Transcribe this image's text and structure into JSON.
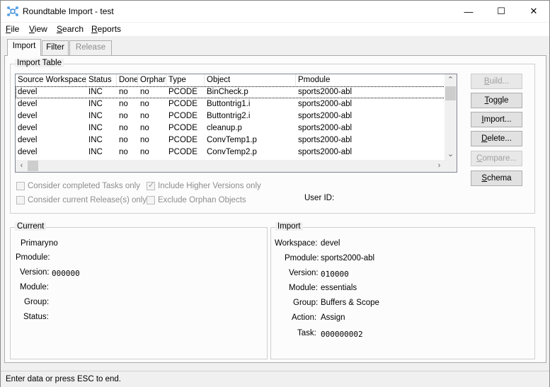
{
  "window": {
    "title": "Roundtable Import - test",
    "controls": {
      "minimize": "—",
      "maximize": "☐",
      "close": "✕"
    }
  },
  "menu": [
    {
      "label": "File",
      "accel": "F",
      "rest": "ile"
    },
    {
      "label": "View",
      "accel": "V",
      "rest": "iew"
    },
    {
      "label": "Search",
      "accel": "S",
      "rest": "earch"
    },
    {
      "label": "Reports",
      "accel": "R",
      "rest": "eports"
    }
  ],
  "tabs": [
    {
      "label": "Import",
      "state": "active"
    },
    {
      "label": "Filter",
      "state": "normal"
    },
    {
      "label": "Release",
      "state": "disabled"
    }
  ],
  "import_table": {
    "group_label": "Import Table",
    "columns": [
      "Source Workspace",
      "Status",
      "Done",
      "Orphan",
      "Type",
      "Object",
      "Pmodule"
    ],
    "rows": [
      [
        "devel",
        "INC",
        "no",
        "no",
        "PCODE",
        "BinCheck.p",
        "sports2000-abl"
      ],
      [
        "devel",
        "INC",
        "no",
        "no",
        "PCODE",
        "Buttontrig1.i",
        "sports2000-abl"
      ],
      [
        "devel",
        "INC",
        "no",
        "no",
        "PCODE",
        "Buttontrig2.i",
        "sports2000-abl"
      ],
      [
        "devel",
        "INC",
        "no",
        "no",
        "PCODE",
        "cleanup.p",
        "sports2000-abl"
      ],
      [
        "devel",
        "INC",
        "no",
        "no",
        "PCODE",
        "ConvTemp1.p",
        "sports2000-abl"
      ],
      [
        "devel",
        "INC",
        "no",
        "no",
        "PCODE",
        "ConvTemp2.p",
        "sports2000-abl"
      ]
    ],
    "selected_row": 0
  },
  "buttons": {
    "build": {
      "accel": "B",
      "rest": "uild...",
      "enabled": false
    },
    "toggle": {
      "accel": "T",
      "rest": "oggle",
      "enabled": true
    },
    "import": {
      "accel": "I",
      "rest": "mport...",
      "enabled": true
    },
    "delete": {
      "accel": "D",
      "rest": "elete...",
      "enabled": true
    },
    "compare": {
      "accel": "C",
      "rest": "ompare...",
      "enabled": false
    },
    "schema": {
      "accel": "S",
      "rest": "chema",
      "enabled": true
    }
  },
  "options": {
    "completed_tasks": {
      "label": "Consider completed Tasks only",
      "checked": false
    },
    "higher_versions": {
      "label": "Include Higher Versions only",
      "checked": true
    },
    "current_release": {
      "label": "Consider current Release(s) only",
      "checked": false
    },
    "exclude_orphan": {
      "label": "Exclude Orphan Objects",
      "checked": false
    },
    "user_id_label": "User ID:"
  },
  "current": {
    "group_label": "Current",
    "primary_label": "Primary:",
    "primary_value": "no",
    "pmodule_label": "Pmodule:",
    "version_label": "Version:",
    "version_value": "000000",
    "module_label": "Module:",
    "group_field_label": "Group:",
    "status_label": "Status:"
  },
  "import": {
    "group_label": "Import",
    "workspace_label": "Workspace:",
    "workspace_value": "devel",
    "pmodule_label": "Pmodule:",
    "pmodule_value": "sports2000-abl",
    "version_label": "Version:",
    "version_value": "010000",
    "module_label": "Module:",
    "module_value": "essentials",
    "group_field_label": "Group:",
    "group_value": "Buffers & Scope",
    "action_label": "Action:",
    "action_value": "Assign",
    "task_label": "Task:",
    "task_value": "000000002"
  },
  "status_bar": "Enter data or press ESC to end.",
  "colors": {
    "accent": "#0078d7",
    "window_bg": "#f0f0f0"
  }
}
